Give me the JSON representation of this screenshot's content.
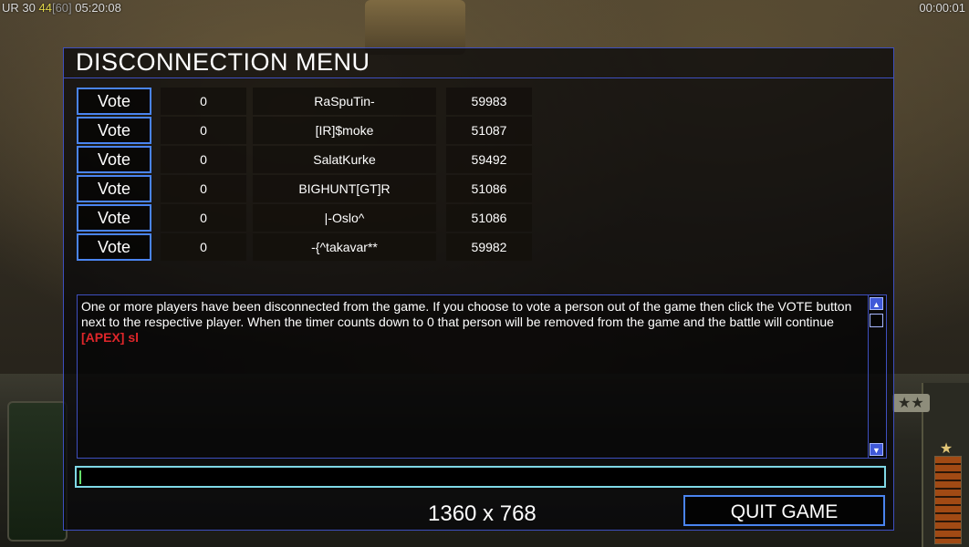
{
  "hud": {
    "stat_prefix": "UR",
    "stat_a": "30",
    "stat_b": "44",
    "stat_c": "[60]",
    "clock": "05:20:08",
    "timer": "00:00:01"
  },
  "dialog": {
    "title": "DISCONNECTION MENU",
    "vote_label": "Vote",
    "players": [
      {
        "count": "0",
        "name": "RaSpuTin-",
        "value": "59983"
      },
      {
        "count": "0",
        "name": "[IR]$moke",
        "value": "51087"
      },
      {
        "count": "0",
        "name": "SalatKurke",
        "value": "59492"
      },
      {
        "count": "0",
        "name": "BIGHUNT[GT]R",
        "value": "51086"
      },
      {
        "count": "0",
        "name": "|-Oslo^",
        "value": "51086"
      },
      {
        "count": "0",
        "name": "-{^takavar**",
        "value": "59982"
      }
    ],
    "message": "One or more players have been disconnected from the game. If you choose to vote a person out of the game then click the VOTE button next to the respective player. When the timer counts down to 0 that person will be removed from the game and the battle will continue",
    "chat_line": "[APEX] sl",
    "resolution": "1360 x 768",
    "quit_label": "QUIT GAME"
  },
  "colors": {
    "accent_border": "#4a84f0",
    "chat_red": "#e0262a",
    "input_border": "#7fd8e6"
  }
}
